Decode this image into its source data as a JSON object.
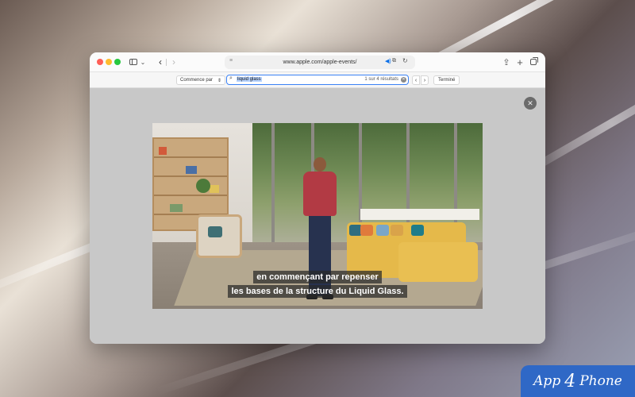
{
  "browser": {
    "address": "www.apple.com/apple-events/",
    "find": {
      "mode_label": "Commence par",
      "query": "liquid glass",
      "result_count": "1 sur 4 résultats",
      "done_label": "Terminé"
    }
  },
  "video": {
    "subtitle_line1": "en commençant par repenser",
    "subtitle_line2": "les bases de la structure du Liquid Glass."
  },
  "watermark": {
    "brand_left": "App",
    "brand_num": "4",
    "brand_right": "Phone"
  },
  "colors": {
    "accent_blue": "#3b82f6",
    "logo_blue": "#2f68c6"
  }
}
